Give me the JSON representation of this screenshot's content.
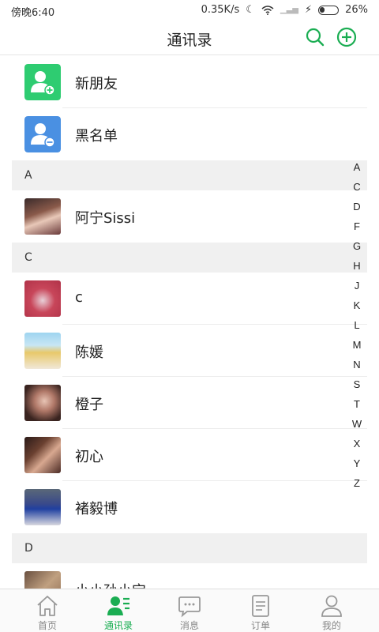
{
  "status_bar": {
    "time": "傍晚6:40",
    "network_speed": "0.35K/s",
    "battery": "26%"
  },
  "header": {
    "title": "通讯录"
  },
  "special_items": [
    {
      "label": "新朋友",
      "icon": "add-friend-icon",
      "color": "#2ecc71"
    },
    {
      "label": "黑名单",
      "icon": "blocked-user-icon",
      "color": "#4a90e2"
    }
  ],
  "sections": [
    {
      "letter": "A",
      "contacts": [
        "阿宁Sissi"
      ]
    },
    {
      "letter": "C",
      "contacts": [
        "c",
        "陈媛",
        "橙子",
        "初心",
        "褚毅博"
      ]
    },
    {
      "letter": "D",
      "contacts": [
        "小小孙小宝"
      ]
    }
  ],
  "alphabet_index": [
    "A",
    "C",
    "D",
    "F",
    "G",
    "H",
    "J",
    "K",
    "L",
    "M",
    "N",
    "S",
    "T",
    "W",
    "X",
    "Y",
    "Z"
  ],
  "tabs": [
    {
      "label": "首页",
      "icon": "home-icon",
      "active": false
    },
    {
      "label": "通讯录",
      "icon": "contacts-icon",
      "active": true
    },
    {
      "label": "消息",
      "icon": "message-icon",
      "active": false
    },
    {
      "label": "订单",
      "icon": "order-icon",
      "active": false
    },
    {
      "label": "我的",
      "icon": "profile-icon",
      "active": false
    }
  ],
  "colors": {
    "accent": "#1aad52",
    "section_bg": "#f0f0f0"
  }
}
